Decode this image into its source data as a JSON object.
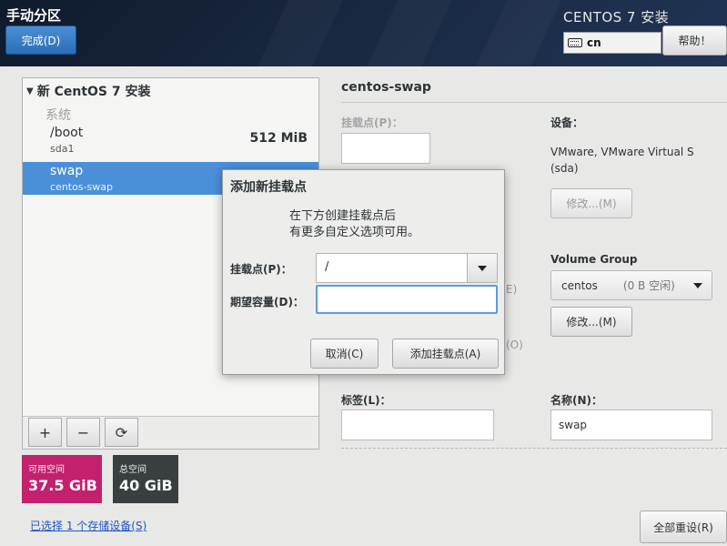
{
  "header": {
    "page_title": "手动分区",
    "done_label": "完成(D)",
    "product_title": "CENTOS 7 安装",
    "keyboard_layout": "cn",
    "help_label": "帮助！"
  },
  "mount_list": {
    "tree_header": "新 CentOS 7 安装",
    "group_label": "系统",
    "items": [
      {
        "name": "/boot",
        "device": "sda1",
        "size": "512 MiB",
        "selected": false
      },
      {
        "name": "swap",
        "device": "centos-swap",
        "size": "",
        "selected": true
      }
    ],
    "toolbar": {
      "add": "+",
      "remove": "−",
      "refresh": "⟳"
    }
  },
  "space": {
    "available_label": "可用空间",
    "available_value": "37.5 GiB",
    "total_label": "总空间",
    "total_value": "40 GiB",
    "available_color": "#c3206d",
    "total_color": "#393f3f"
  },
  "storage_link": "已选择 1 个存储设备(S)",
  "detail": {
    "title": "centos-swap",
    "mount_point_label": "挂载点(P)：",
    "device_label": "设备：",
    "device_value_line1": "VMware, VMware Virtual S",
    "device_value_line2": "(sda)",
    "modify_label": "修改...(M)",
    "volume_group_label": "Volume Group",
    "volume_group_name": "centos",
    "volume_group_free": "(0 B 空闲)",
    "vg_modify_label": "修改...(M)",
    "peek_e": "E)",
    "peek_o": "(O)",
    "tag_label": "标签(L)：",
    "name_label": "名称(N)：",
    "name_value": "swap",
    "reset_all_label": "全部重设(R)"
  },
  "dialog": {
    "title": "添加新挂载点",
    "desc_line1": "在下方创建挂载点后",
    "desc_line2": "有更多自定义选项可用。",
    "mount_point_label": "挂载点(P)：",
    "mount_point_value": "/",
    "capacity_label": "期望容量(D)：",
    "capacity_value": "",
    "cancel_label": "取消(C)",
    "add_label": "添加挂载点(A)"
  },
  "colors": {
    "selection": "#4a90d9",
    "focus_border": "#5b9ce0"
  }
}
